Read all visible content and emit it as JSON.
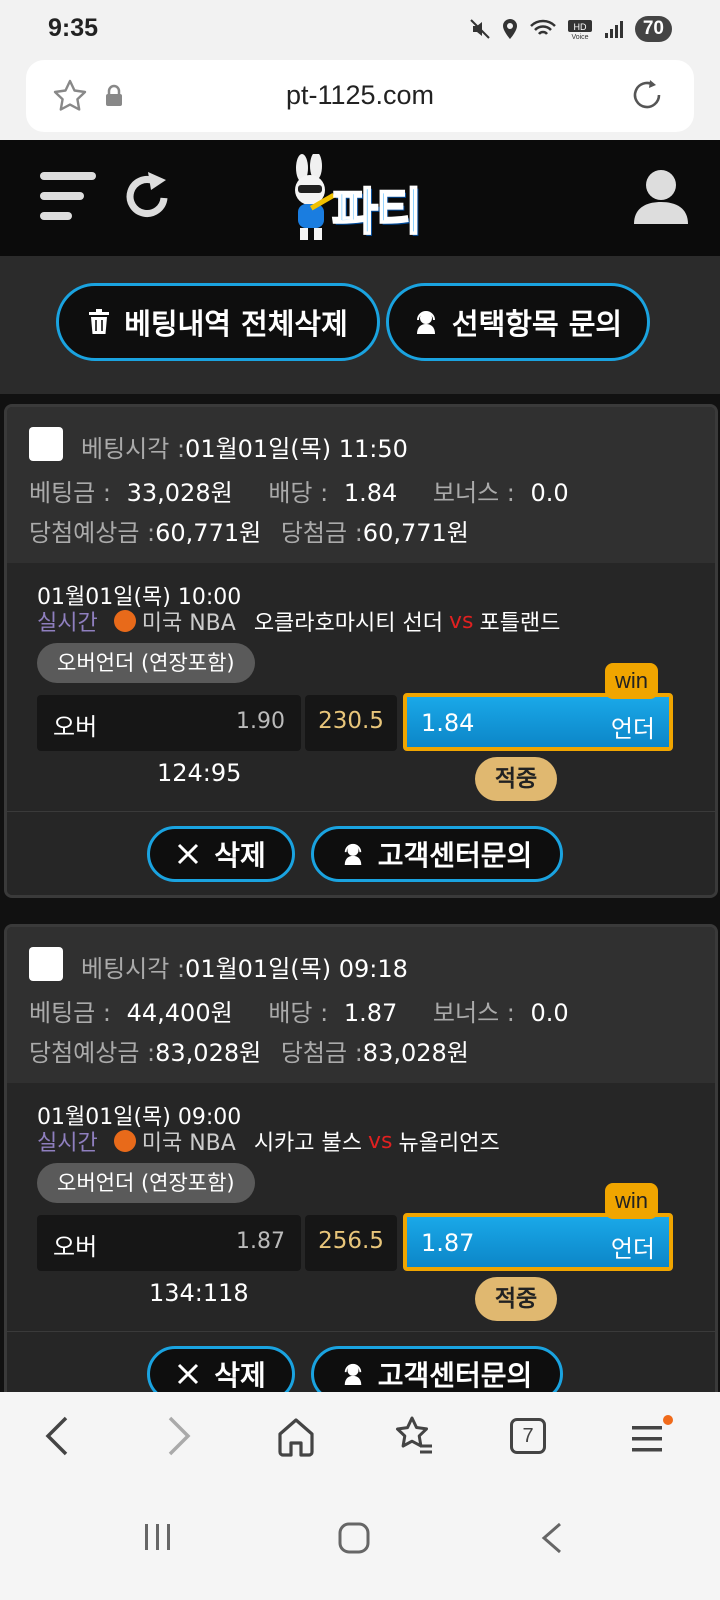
{
  "status": {
    "time": "9:35",
    "battery": "70"
  },
  "browser": {
    "url": "pt-1125.com",
    "tab_count": "7"
  },
  "site": {
    "logo_text": "파티"
  },
  "actions": {
    "delete_all": "베팅내역 전체삭제",
    "inquire_selected": "선택항목 문의"
  },
  "labels": {
    "bet_time": "베팅시각 :",
    "bet_amount": "베팅금 :",
    "odds": "배당 :",
    "bonus": "보너스 :",
    "expected": "당첨예상금 :",
    "payout": "당첨금 :",
    "delete": "삭제",
    "support": "고객센터문의",
    "win": "win",
    "hit": "적중",
    "vs": "vs",
    "live": "실시간",
    "league": "미국 NBA",
    "market": "오버언더 (연장포함)"
  },
  "bets": [
    {
      "time": "01월01일(목) 11:50",
      "amount": "33,028원",
      "odds": "1.84",
      "bonus": "0.0",
      "expected": "60,771원",
      "payout": "60,771원",
      "game_date": "01월01일(목) 10:00",
      "home": "오클라호마시티 선더",
      "away": "포틀랜드",
      "over_label": "오버",
      "over_odds": "1.90",
      "line": "230.5",
      "under_odds": "1.84",
      "under_label": "언더",
      "score": "124:95"
    },
    {
      "time": "01월01일(목) 09:18",
      "amount": "44,400원",
      "odds": "1.87",
      "bonus": "0.0",
      "expected": "83,028원",
      "payout": "83,028원",
      "game_date": "01월01일(목) 09:00",
      "home": "시카고 불스",
      "away": "뉴올리언즈",
      "over_label": "오버",
      "over_odds": "1.87",
      "line": "256.5",
      "under_odds": "1.87",
      "under_label": "언더",
      "score": "134:118"
    }
  ]
}
